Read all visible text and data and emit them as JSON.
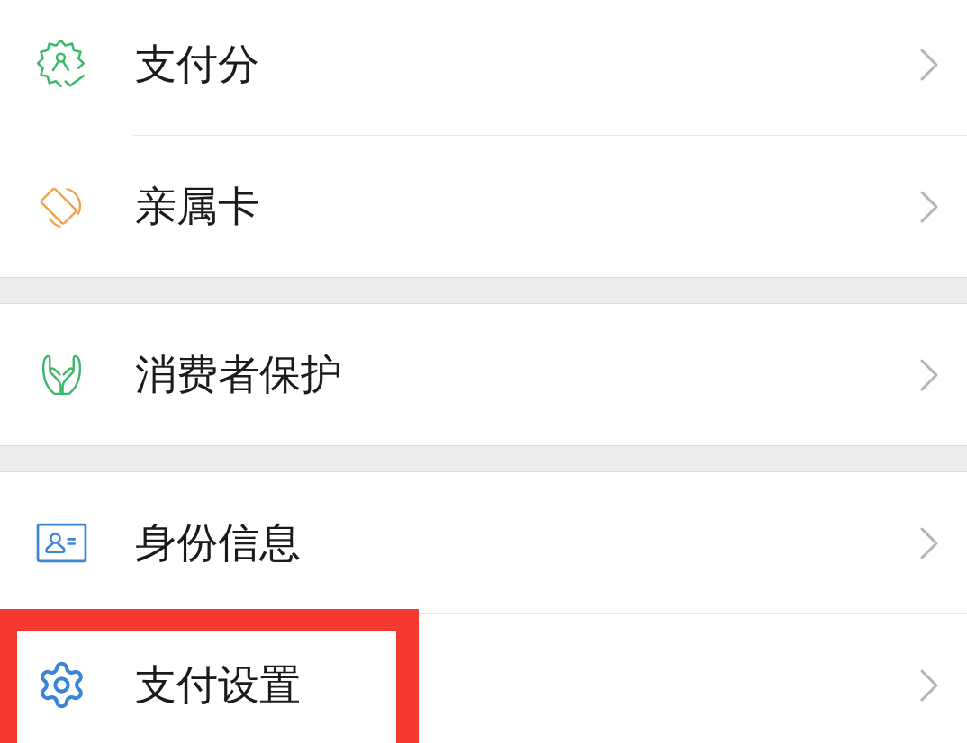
{
  "groups": [
    {
      "items": [
        {
          "label": "支付分",
          "highlighted": false
        },
        {
          "label": "亲属卡",
          "highlighted": false
        }
      ]
    },
    {
      "items": [
        {
          "label": "消费者保护",
          "highlighted": false
        }
      ]
    },
    {
      "items": [
        {
          "label": "身份信息",
          "highlighted": false
        },
        {
          "label": "支付设置",
          "highlighted": true
        }
      ]
    }
  ]
}
